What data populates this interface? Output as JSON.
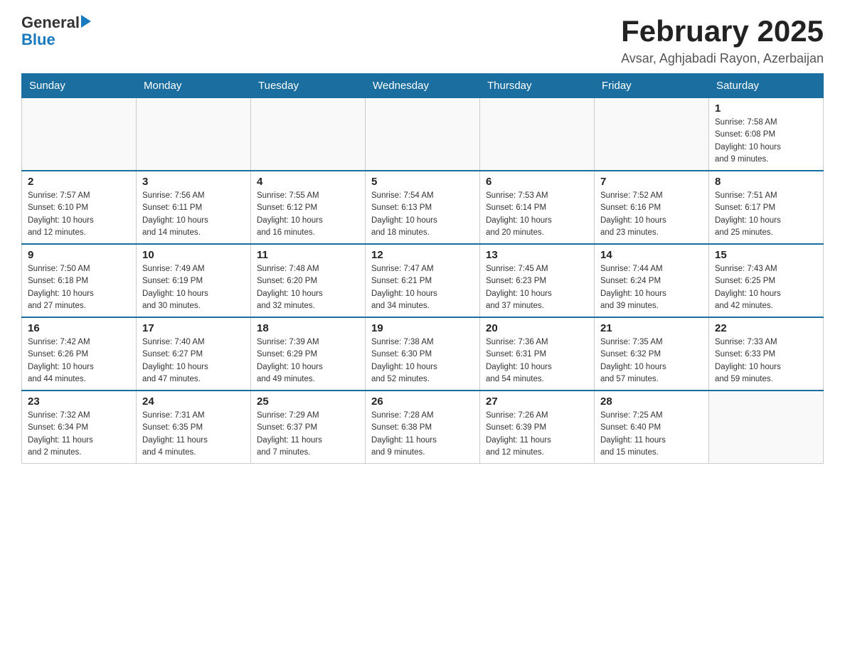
{
  "logo": {
    "general": "General",
    "blue": "Blue"
  },
  "header": {
    "title": "February 2025",
    "subtitle": "Avsar, Aghjabadi Rayon, Azerbaijan"
  },
  "weekdays": [
    "Sunday",
    "Monday",
    "Tuesday",
    "Wednesday",
    "Thursday",
    "Friday",
    "Saturday"
  ],
  "weeks": [
    [
      {
        "day": "",
        "info": ""
      },
      {
        "day": "",
        "info": ""
      },
      {
        "day": "",
        "info": ""
      },
      {
        "day": "",
        "info": ""
      },
      {
        "day": "",
        "info": ""
      },
      {
        "day": "",
        "info": ""
      },
      {
        "day": "1",
        "info": "Sunrise: 7:58 AM\nSunset: 6:08 PM\nDaylight: 10 hours\nand 9 minutes."
      }
    ],
    [
      {
        "day": "2",
        "info": "Sunrise: 7:57 AM\nSunset: 6:10 PM\nDaylight: 10 hours\nand 12 minutes."
      },
      {
        "day": "3",
        "info": "Sunrise: 7:56 AM\nSunset: 6:11 PM\nDaylight: 10 hours\nand 14 minutes."
      },
      {
        "day": "4",
        "info": "Sunrise: 7:55 AM\nSunset: 6:12 PM\nDaylight: 10 hours\nand 16 minutes."
      },
      {
        "day": "5",
        "info": "Sunrise: 7:54 AM\nSunset: 6:13 PM\nDaylight: 10 hours\nand 18 minutes."
      },
      {
        "day": "6",
        "info": "Sunrise: 7:53 AM\nSunset: 6:14 PM\nDaylight: 10 hours\nand 20 minutes."
      },
      {
        "day": "7",
        "info": "Sunrise: 7:52 AM\nSunset: 6:16 PM\nDaylight: 10 hours\nand 23 minutes."
      },
      {
        "day": "8",
        "info": "Sunrise: 7:51 AM\nSunset: 6:17 PM\nDaylight: 10 hours\nand 25 minutes."
      }
    ],
    [
      {
        "day": "9",
        "info": "Sunrise: 7:50 AM\nSunset: 6:18 PM\nDaylight: 10 hours\nand 27 minutes."
      },
      {
        "day": "10",
        "info": "Sunrise: 7:49 AM\nSunset: 6:19 PM\nDaylight: 10 hours\nand 30 minutes."
      },
      {
        "day": "11",
        "info": "Sunrise: 7:48 AM\nSunset: 6:20 PM\nDaylight: 10 hours\nand 32 minutes."
      },
      {
        "day": "12",
        "info": "Sunrise: 7:47 AM\nSunset: 6:21 PM\nDaylight: 10 hours\nand 34 minutes."
      },
      {
        "day": "13",
        "info": "Sunrise: 7:45 AM\nSunset: 6:23 PM\nDaylight: 10 hours\nand 37 minutes."
      },
      {
        "day": "14",
        "info": "Sunrise: 7:44 AM\nSunset: 6:24 PM\nDaylight: 10 hours\nand 39 minutes."
      },
      {
        "day": "15",
        "info": "Sunrise: 7:43 AM\nSunset: 6:25 PM\nDaylight: 10 hours\nand 42 minutes."
      }
    ],
    [
      {
        "day": "16",
        "info": "Sunrise: 7:42 AM\nSunset: 6:26 PM\nDaylight: 10 hours\nand 44 minutes."
      },
      {
        "day": "17",
        "info": "Sunrise: 7:40 AM\nSunset: 6:27 PM\nDaylight: 10 hours\nand 47 minutes."
      },
      {
        "day": "18",
        "info": "Sunrise: 7:39 AM\nSunset: 6:29 PM\nDaylight: 10 hours\nand 49 minutes."
      },
      {
        "day": "19",
        "info": "Sunrise: 7:38 AM\nSunset: 6:30 PM\nDaylight: 10 hours\nand 52 minutes."
      },
      {
        "day": "20",
        "info": "Sunrise: 7:36 AM\nSunset: 6:31 PM\nDaylight: 10 hours\nand 54 minutes."
      },
      {
        "day": "21",
        "info": "Sunrise: 7:35 AM\nSunset: 6:32 PM\nDaylight: 10 hours\nand 57 minutes."
      },
      {
        "day": "22",
        "info": "Sunrise: 7:33 AM\nSunset: 6:33 PM\nDaylight: 10 hours\nand 59 minutes."
      }
    ],
    [
      {
        "day": "23",
        "info": "Sunrise: 7:32 AM\nSunset: 6:34 PM\nDaylight: 11 hours\nand 2 minutes."
      },
      {
        "day": "24",
        "info": "Sunrise: 7:31 AM\nSunset: 6:35 PM\nDaylight: 11 hours\nand 4 minutes."
      },
      {
        "day": "25",
        "info": "Sunrise: 7:29 AM\nSunset: 6:37 PM\nDaylight: 11 hours\nand 7 minutes."
      },
      {
        "day": "26",
        "info": "Sunrise: 7:28 AM\nSunset: 6:38 PM\nDaylight: 11 hours\nand 9 minutes."
      },
      {
        "day": "27",
        "info": "Sunrise: 7:26 AM\nSunset: 6:39 PM\nDaylight: 11 hours\nand 12 minutes."
      },
      {
        "day": "28",
        "info": "Sunrise: 7:25 AM\nSunset: 6:40 PM\nDaylight: 11 hours\nand 15 minutes."
      },
      {
        "day": "",
        "info": ""
      }
    ]
  ]
}
